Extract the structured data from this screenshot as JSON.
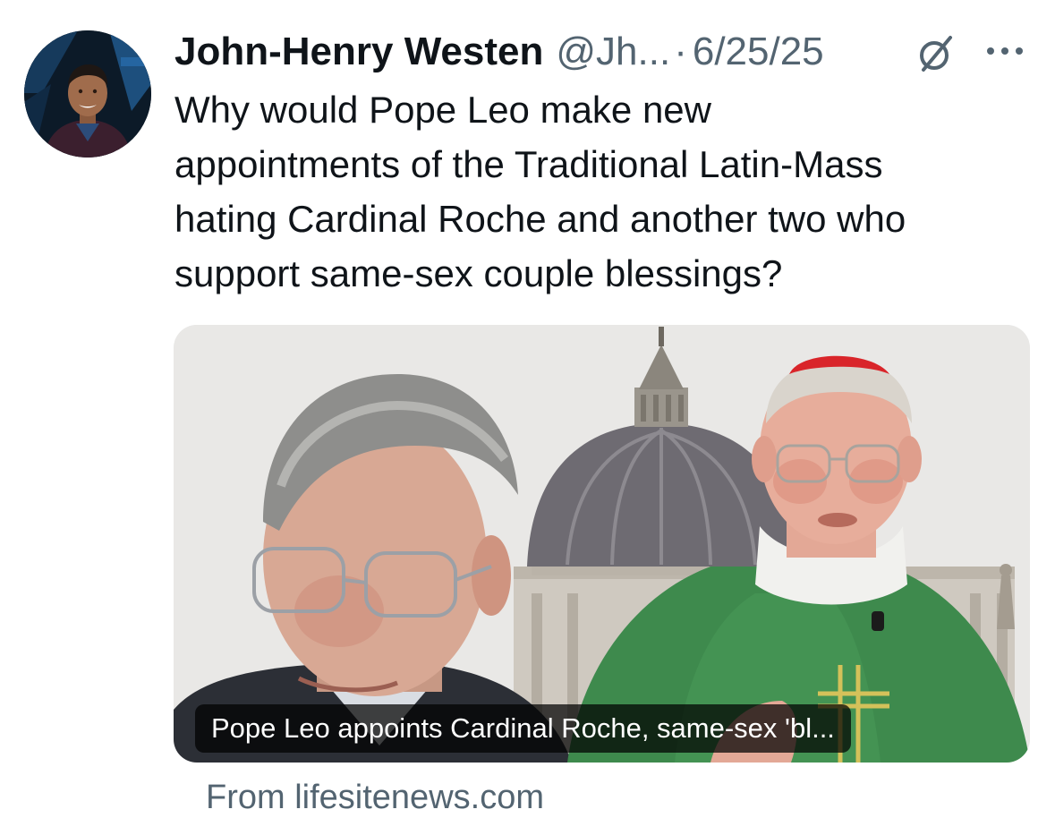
{
  "author": {
    "display_name": "John-Henry Westen",
    "handle": "@Jh...",
    "separator": "·",
    "date": "6/25/25"
  },
  "tweet": {
    "text": "Why would Pope Leo make new\nappointments of the Traditional Latin-Mass\nhating Cardinal Roche and another two who\nsupport same-sex couple blessings?"
  },
  "link_card": {
    "title": "Pope Leo appoints Cardinal Roche, same-sex 'bl...",
    "source": "From lifesitenews.com"
  },
  "icons": {
    "grok": "grok-icon",
    "more": "more-icon"
  },
  "colors": {
    "text_primary": "#0f1419",
    "text_secondary": "#536471",
    "background": "#ffffff",
    "vestment_green": "#3e8a4d",
    "zucchetto_red": "#d9252a"
  }
}
